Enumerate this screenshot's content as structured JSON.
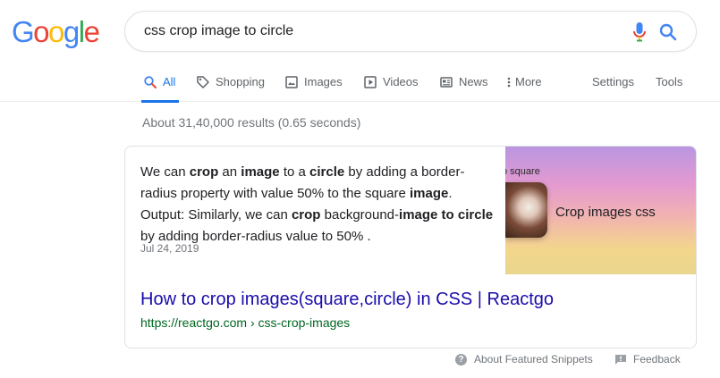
{
  "logo": {
    "text": "Google",
    "letters": [
      {
        "ch": "G",
        "color": "#4285F4"
      },
      {
        "ch": "o",
        "color": "#EA4335"
      },
      {
        "ch": "o",
        "color": "#FBBC05"
      },
      {
        "ch": "g",
        "color": "#4285F4"
      },
      {
        "ch": "l",
        "color": "#34A853"
      },
      {
        "ch": "e",
        "color": "#EA4335"
      }
    ]
  },
  "search": {
    "query": "css crop image to circle"
  },
  "tabs": [
    {
      "label": "All",
      "icon": "search-icon",
      "active": true
    },
    {
      "label": "Shopping",
      "icon": "tag-icon"
    },
    {
      "label": "Images",
      "icon": "image-icon"
    },
    {
      "label": "Videos",
      "icon": "play-icon"
    },
    {
      "label": "News",
      "icon": "news-icon"
    },
    {
      "label": "More",
      "icon": "more-vert-icon"
    },
    {
      "label": "Settings"
    },
    {
      "label": "Tools"
    }
  ],
  "stats": "About 31,40,000 results (0.65 seconds)",
  "featured": {
    "snippet_parts": [
      {
        "t": "We can ",
        "b": false
      },
      {
        "t": "crop",
        "b": true
      },
      {
        "t": " an ",
        "b": false
      },
      {
        "t": "image",
        "b": true
      },
      {
        "t": " to a ",
        "b": false
      },
      {
        "t": "circle",
        "b": true
      },
      {
        "t": " by adding a border-radius property with value 50% to the square ",
        "b": false
      },
      {
        "t": "image",
        "b": true
      },
      {
        "t": ". Output: Similarly, we can ",
        "b": false
      },
      {
        "t": "crop",
        "b": true
      },
      {
        "t": " background-",
        "b": false
      },
      {
        "t": "image to circle",
        "b": true
      },
      {
        "t": " by adding border-radius value to 50% .",
        "b": false
      }
    ],
    "date": "Jul 24, 2019",
    "thumbnail_text_top": "o square",
    "thumbnail_text_main": "Crop images css",
    "title": "How to crop images(square,circle) in CSS | Reactgo",
    "cite": "https://reactgo.com › css-crop-images"
  },
  "footer": {
    "about": "About Featured Snippets",
    "feedback": "Feedback"
  },
  "colors": {
    "link": "#1a0dab",
    "cite": "#006621",
    "accent": "#1a73e8"
  }
}
